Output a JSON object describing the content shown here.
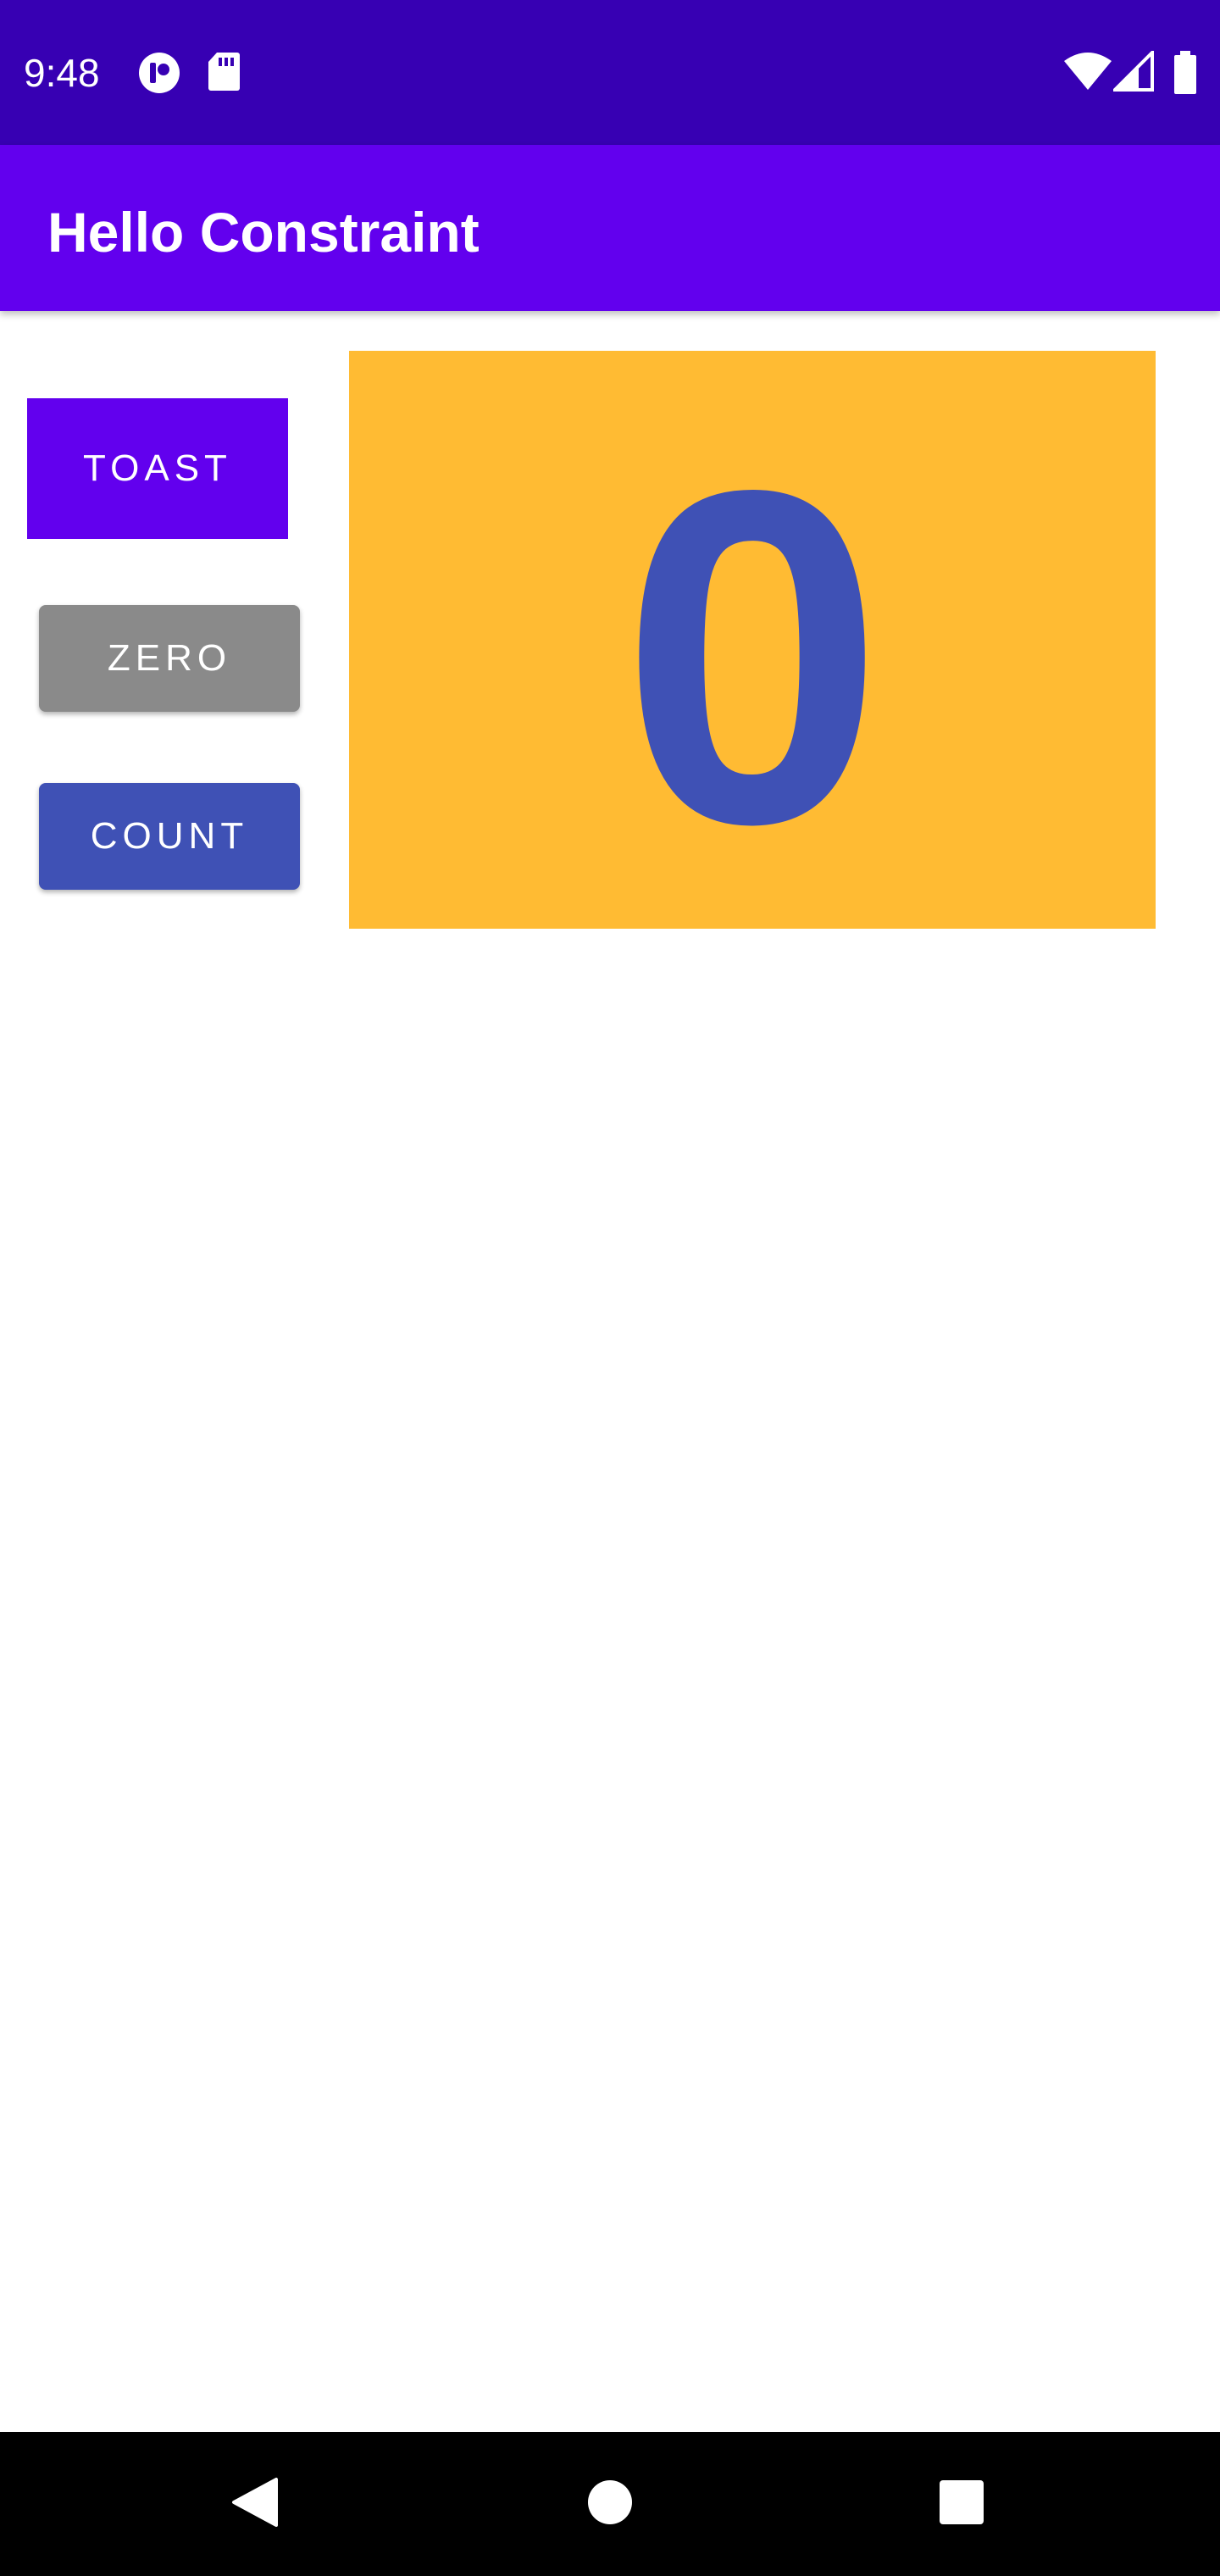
{
  "status_bar": {
    "time": "9:48",
    "icons_left": [
      "circle-notification-icon",
      "sd-card-icon"
    ],
    "icons_right": [
      "wifi-icon",
      "cell-signal-icon",
      "battery-icon"
    ],
    "background": "#3700b3"
  },
  "app_bar": {
    "title": "Hello Constraint",
    "background": "#6200ee"
  },
  "buttons": {
    "toast_label": "TOAST",
    "zero_label": "ZERO",
    "count_label": "COUNT"
  },
  "counter": {
    "value": "0",
    "background": "#ffbb33",
    "text_color": "#3f51b5"
  },
  "nav_bar": {
    "icons": [
      "back-icon",
      "home-icon",
      "recents-icon"
    ]
  }
}
